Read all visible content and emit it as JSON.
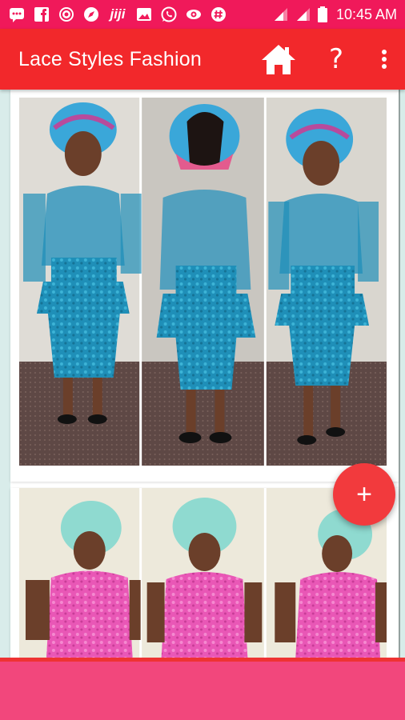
{
  "status_bar": {
    "time": "10:45 AM",
    "left_icons": [
      "message-icon",
      "facebook-icon",
      "vine-icon",
      "compass-icon",
      "jiji-icon",
      "gallery-icon",
      "whatsapp-icon",
      "eye-icon",
      "hash-icon"
    ],
    "jiji_text": "jiji",
    "right_icons": [
      "signal-icon",
      "signal-icon",
      "battery-icon"
    ]
  },
  "app_bar": {
    "title": "Lace Styles Fashion",
    "help_symbol": "?",
    "actions": [
      "home-icon",
      "help-icon",
      "overflow-menu-icon"
    ]
  },
  "feed": {
    "items": [
      {
        "label": "turquoise-lace-peplum-dress"
      },
      {
        "label": "pink-lace-dress"
      }
    ]
  },
  "fab": {
    "symbol": "+"
  },
  "colors": {
    "status_bar": "#f0195a",
    "app_bar": "#f2282b",
    "fab": "#f23a3d",
    "bottom_banner": "#f2477c"
  }
}
